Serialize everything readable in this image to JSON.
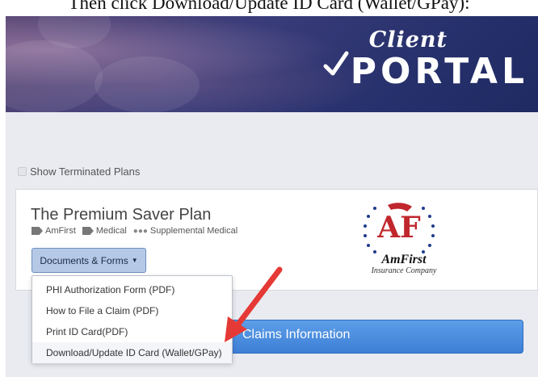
{
  "instruction": "Then click Download/Update ID Card (Wallet/GPay):",
  "banner": {
    "logo_script": "Client",
    "logo_main": "PORTAL"
  },
  "controls": {
    "show_terminated_label": "Show Terminated Plans",
    "show_terminated_checked": false
  },
  "plan": {
    "title": "The Premium Saver Plan",
    "tags": [
      {
        "label": "AmFirst",
        "icon": "tag-icon"
      },
      {
        "label": "Medical",
        "icon": "tag-icon"
      },
      {
        "label": "Supplemental Medical",
        "icon": "group-icon"
      }
    ],
    "documents_button": "Documents & Forms",
    "carrier_logo": {
      "monogram": "AF",
      "name": "AmFirst",
      "subtitle": "Insurance Company"
    }
  },
  "dropdown": {
    "items": [
      "PHI Authorization Form (PDF)",
      "How to File a Claim (PDF)",
      "Print ID Card(PDF)",
      "Download/Update ID Card (Wallet/GPay)"
    ]
  },
  "claims": {
    "label": "Claims Information"
  },
  "colors": {
    "accent_blue": "#4a8ae0",
    "annotation_arrow": "#e53935",
    "logo_red": "#c0272d"
  }
}
